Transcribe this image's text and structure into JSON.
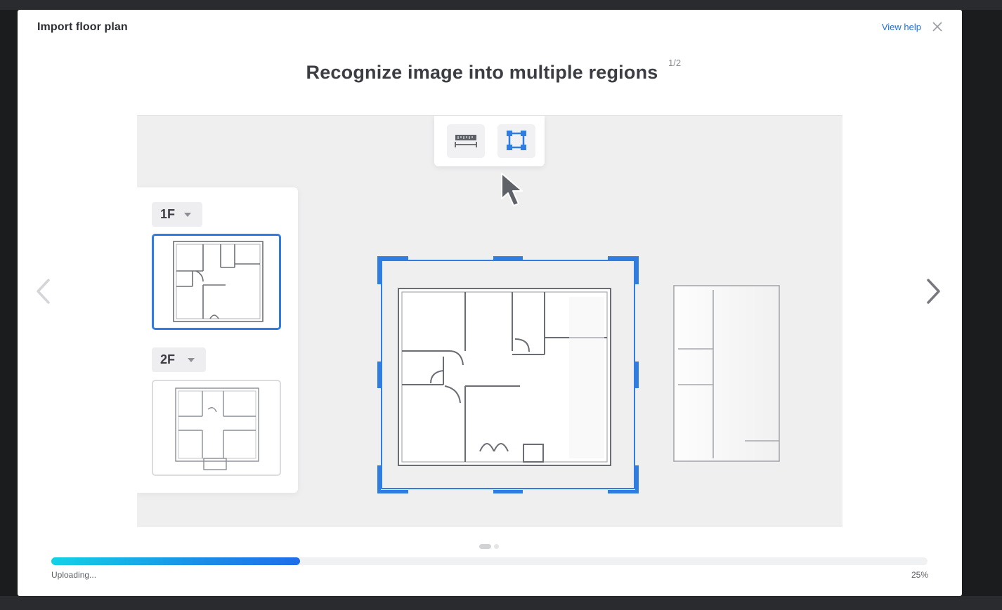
{
  "dialog": {
    "title": "Import floor plan",
    "help_link": "View help",
    "close_icon": "close-icon"
  },
  "heading": {
    "text": "Recognize image into multiple regions",
    "step": "1/2"
  },
  "toolbar": {
    "tools": [
      {
        "icon": "ruler-icon"
      },
      {
        "icon": "region-select-icon",
        "color": "#2f7de1"
      }
    ]
  },
  "floors": [
    {
      "label": "1F",
      "selected": true
    },
    {
      "label": "2F",
      "selected": false
    }
  ],
  "carousel": {
    "prev_icon": "chevron-left-icon",
    "next_icon": "chevron-right-icon",
    "page_count": 2,
    "active_page": 1
  },
  "upload": {
    "status": "Uploading...",
    "percent_label": "25%",
    "progress": 0.284
  },
  "colors": {
    "accent": "#2f7de1",
    "link": "#1f6fdc",
    "progress_start": "#13d2e6",
    "progress_end": "#1f6ee8"
  }
}
